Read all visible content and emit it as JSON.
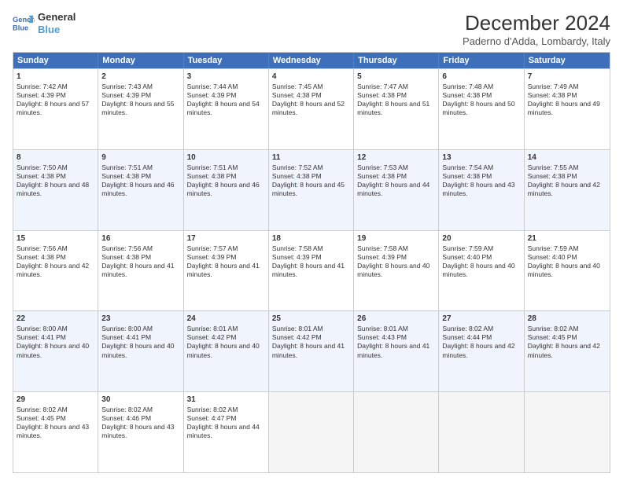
{
  "logo": {
    "line1": "General",
    "line2": "Blue"
  },
  "title": "December 2024",
  "subtitle": "Paderno d'Adda, Lombardy, Italy",
  "weekdays": [
    "Sunday",
    "Monday",
    "Tuesday",
    "Wednesday",
    "Thursday",
    "Friday",
    "Saturday"
  ],
  "weeks": [
    [
      {
        "day": "1",
        "sunrise": "Sunrise: 7:42 AM",
        "sunset": "Sunset: 4:39 PM",
        "daylight": "Daylight: 8 hours and 57 minutes."
      },
      {
        "day": "2",
        "sunrise": "Sunrise: 7:43 AM",
        "sunset": "Sunset: 4:39 PM",
        "daylight": "Daylight: 8 hours and 55 minutes."
      },
      {
        "day": "3",
        "sunrise": "Sunrise: 7:44 AM",
        "sunset": "Sunset: 4:39 PM",
        "daylight": "Daylight: 8 hours and 54 minutes."
      },
      {
        "day": "4",
        "sunrise": "Sunrise: 7:45 AM",
        "sunset": "Sunset: 4:38 PM",
        "daylight": "Daylight: 8 hours and 52 minutes."
      },
      {
        "day": "5",
        "sunrise": "Sunrise: 7:47 AM",
        "sunset": "Sunset: 4:38 PM",
        "daylight": "Daylight: 8 hours and 51 minutes."
      },
      {
        "day": "6",
        "sunrise": "Sunrise: 7:48 AM",
        "sunset": "Sunset: 4:38 PM",
        "daylight": "Daylight: 8 hours and 50 minutes."
      },
      {
        "day": "7",
        "sunrise": "Sunrise: 7:49 AM",
        "sunset": "Sunset: 4:38 PM",
        "daylight": "Daylight: 8 hours and 49 minutes."
      }
    ],
    [
      {
        "day": "8",
        "sunrise": "Sunrise: 7:50 AM",
        "sunset": "Sunset: 4:38 PM",
        "daylight": "Daylight: 8 hours and 48 minutes."
      },
      {
        "day": "9",
        "sunrise": "Sunrise: 7:51 AM",
        "sunset": "Sunset: 4:38 PM",
        "daylight": "Daylight: 8 hours and 46 minutes."
      },
      {
        "day": "10",
        "sunrise": "Sunrise: 7:51 AM",
        "sunset": "Sunset: 4:38 PM",
        "daylight": "Daylight: 8 hours and 46 minutes."
      },
      {
        "day": "11",
        "sunrise": "Sunrise: 7:52 AM",
        "sunset": "Sunset: 4:38 PM",
        "daylight": "Daylight: 8 hours and 45 minutes."
      },
      {
        "day": "12",
        "sunrise": "Sunrise: 7:53 AM",
        "sunset": "Sunset: 4:38 PM",
        "daylight": "Daylight: 8 hours and 44 minutes."
      },
      {
        "day": "13",
        "sunrise": "Sunrise: 7:54 AM",
        "sunset": "Sunset: 4:38 PM",
        "daylight": "Daylight: 8 hours and 43 minutes."
      },
      {
        "day": "14",
        "sunrise": "Sunrise: 7:55 AM",
        "sunset": "Sunset: 4:38 PM",
        "daylight": "Daylight: 8 hours and 42 minutes."
      }
    ],
    [
      {
        "day": "15",
        "sunrise": "Sunrise: 7:56 AM",
        "sunset": "Sunset: 4:38 PM",
        "daylight": "Daylight: 8 hours and 42 minutes."
      },
      {
        "day": "16",
        "sunrise": "Sunrise: 7:56 AM",
        "sunset": "Sunset: 4:38 PM",
        "daylight": "Daylight: 8 hours and 41 minutes."
      },
      {
        "day": "17",
        "sunrise": "Sunrise: 7:57 AM",
        "sunset": "Sunset: 4:39 PM",
        "daylight": "Daylight: 8 hours and 41 minutes."
      },
      {
        "day": "18",
        "sunrise": "Sunrise: 7:58 AM",
        "sunset": "Sunset: 4:39 PM",
        "daylight": "Daylight: 8 hours and 41 minutes."
      },
      {
        "day": "19",
        "sunrise": "Sunrise: 7:58 AM",
        "sunset": "Sunset: 4:39 PM",
        "daylight": "Daylight: 8 hours and 40 minutes."
      },
      {
        "day": "20",
        "sunrise": "Sunrise: 7:59 AM",
        "sunset": "Sunset: 4:40 PM",
        "daylight": "Daylight: 8 hours and 40 minutes."
      },
      {
        "day": "21",
        "sunrise": "Sunrise: 7:59 AM",
        "sunset": "Sunset: 4:40 PM",
        "daylight": "Daylight: 8 hours and 40 minutes."
      }
    ],
    [
      {
        "day": "22",
        "sunrise": "Sunrise: 8:00 AM",
        "sunset": "Sunset: 4:41 PM",
        "daylight": "Daylight: 8 hours and 40 minutes."
      },
      {
        "day": "23",
        "sunrise": "Sunrise: 8:00 AM",
        "sunset": "Sunset: 4:41 PM",
        "daylight": "Daylight: 8 hours and 40 minutes."
      },
      {
        "day": "24",
        "sunrise": "Sunrise: 8:01 AM",
        "sunset": "Sunset: 4:42 PM",
        "daylight": "Daylight: 8 hours and 40 minutes."
      },
      {
        "day": "25",
        "sunrise": "Sunrise: 8:01 AM",
        "sunset": "Sunset: 4:42 PM",
        "daylight": "Daylight: 8 hours and 41 minutes."
      },
      {
        "day": "26",
        "sunrise": "Sunrise: 8:01 AM",
        "sunset": "Sunset: 4:43 PM",
        "daylight": "Daylight: 8 hours and 41 minutes."
      },
      {
        "day": "27",
        "sunrise": "Sunrise: 8:02 AM",
        "sunset": "Sunset: 4:44 PM",
        "daylight": "Daylight: 8 hours and 42 minutes."
      },
      {
        "day": "28",
        "sunrise": "Sunrise: 8:02 AM",
        "sunset": "Sunset: 4:45 PM",
        "daylight": "Daylight: 8 hours and 42 minutes."
      }
    ],
    [
      {
        "day": "29",
        "sunrise": "Sunrise: 8:02 AM",
        "sunset": "Sunset: 4:45 PM",
        "daylight": "Daylight: 8 hours and 43 minutes."
      },
      {
        "day": "30",
        "sunrise": "Sunrise: 8:02 AM",
        "sunset": "Sunset: 4:46 PM",
        "daylight": "Daylight: 8 hours and 43 minutes."
      },
      {
        "day": "31",
        "sunrise": "Sunrise: 8:02 AM",
        "sunset": "Sunset: 4:47 PM",
        "daylight": "Daylight: 8 hours and 44 minutes."
      },
      null,
      null,
      null,
      null
    ]
  ]
}
